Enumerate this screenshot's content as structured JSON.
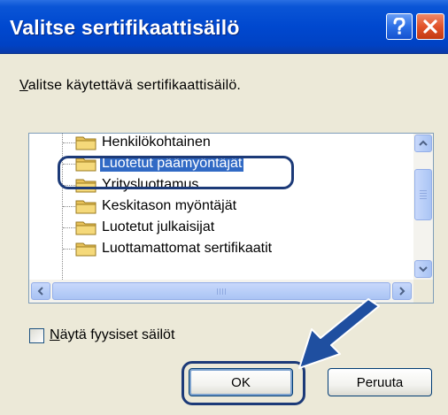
{
  "window": {
    "title": "Valitse sertifikaattisäilö",
    "help_icon": "question-mark-icon",
    "close_icon": "close-x-icon"
  },
  "instruction": {
    "accesskey": "V",
    "rest": "alitse käytettävä sertifikaattisäilö."
  },
  "tree": {
    "items": [
      {
        "label": "Henkilökohtainen",
        "icon": "folder-icon",
        "selected": false
      },
      {
        "label": "Luotetut päämyöntäjät",
        "icon": "folder-icon",
        "selected": true
      },
      {
        "label": "Yritysluottamus",
        "icon": "folder-icon",
        "selected": false
      },
      {
        "label": "Keskitason myöntäjät",
        "icon": "folder-icon",
        "selected": false
      },
      {
        "label": "Luotetut julkaisijat",
        "icon": "folder-icon",
        "selected": false
      },
      {
        "label": "Luottamattomat sertifikaatit",
        "icon": "folder-icon",
        "selected": false
      }
    ]
  },
  "checkbox": {
    "accesskey": "N",
    "rest": "äytä fyysiset säilöt",
    "checked": false
  },
  "buttons": {
    "ok_label": "OK",
    "cancel_label": "Peruuta"
  },
  "colors": {
    "titlebar": "#0048cf",
    "selection": "#316ac5",
    "annotation": "#1c3a78"
  }
}
